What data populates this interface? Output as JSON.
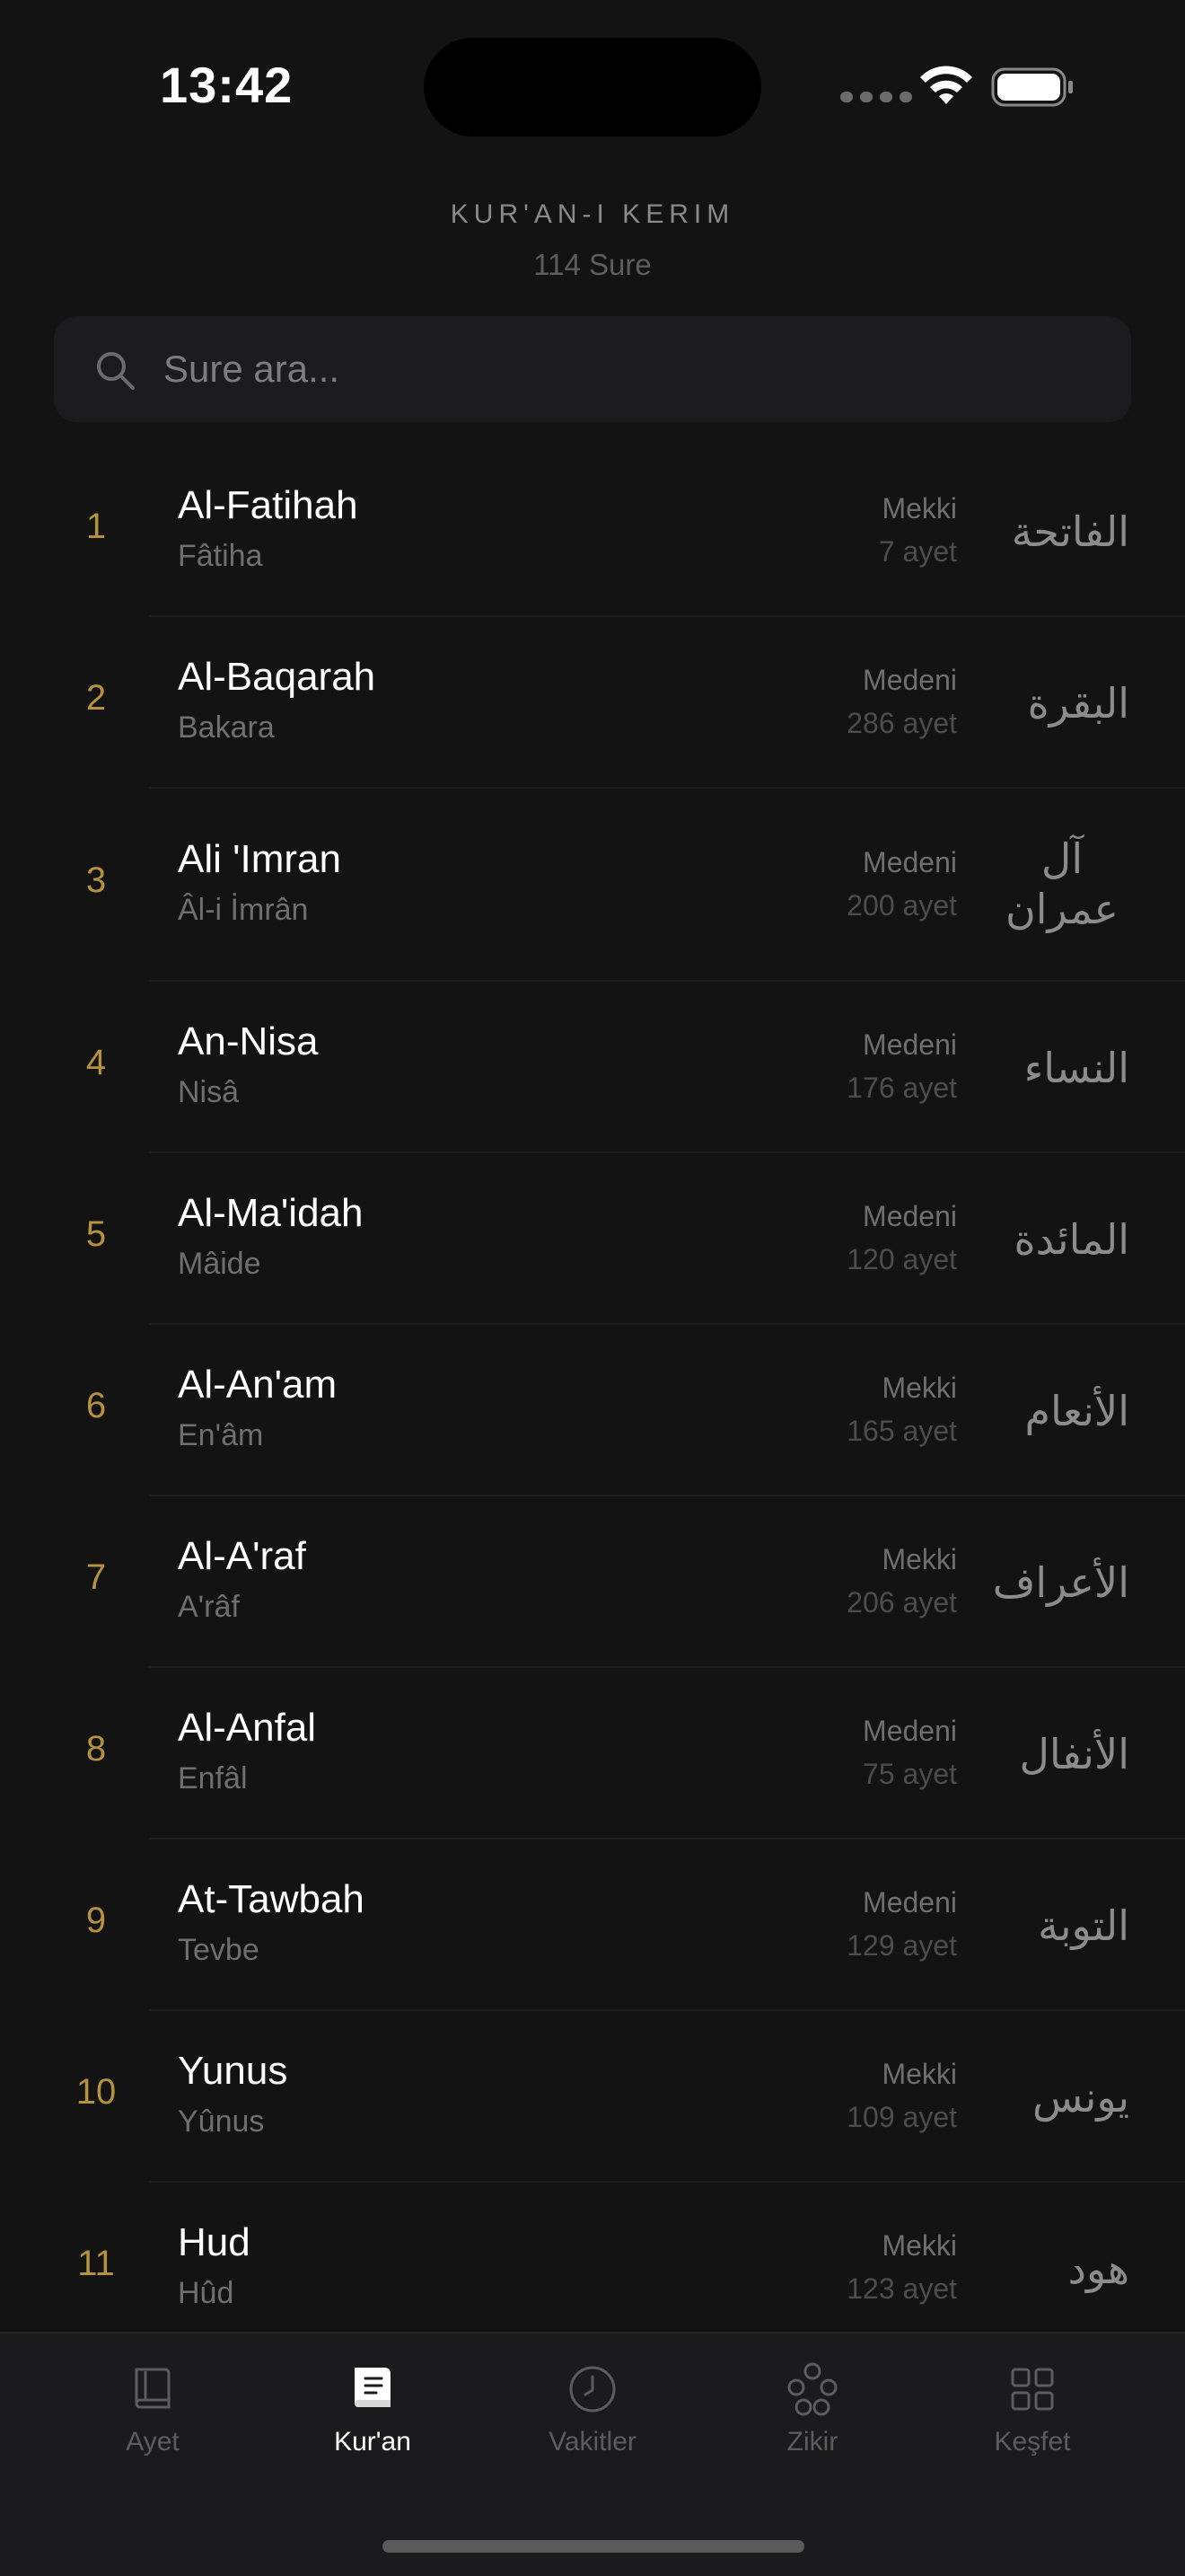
{
  "status_bar": {
    "time": "13:42"
  },
  "header": {
    "title": "KUR'AN-I KERIM",
    "subtitle": "114 Sure"
  },
  "search": {
    "placeholder": "Sure ara..."
  },
  "surahs": [
    {
      "number": "1",
      "name": "Al-Fatihah",
      "turkish": "Fâtiha",
      "type": "Mekki",
      "verses": "7 ayet",
      "arabic": "الفاتحة"
    },
    {
      "number": "2",
      "name": "Al-Baqarah",
      "turkish": "Bakara",
      "type": "Medeni",
      "verses": "286 ayet",
      "arabic": "البقرة"
    },
    {
      "number": "3",
      "name": "Ali 'Imran",
      "turkish": "Âl-i İmrân",
      "type": "Medeni",
      "verses": "200 ayet",
      "arabic": "آل عمران"
    },
    {
      "number": "4",
      "name": "An-Nisa",
      "turkish": "Nisâ",
      "type": "Medeni",
      "verses": "176 ayet",
      "arabic": "النساء"
    },
    {
      "number": "5",
      "name": "Al-Ma'idah",
      "turkish": "Mâide",
      "type": "Medeni",
      "verses": "120 ayet",
      "arabic": "المائدة"
    },
    {
      "number": "6",
      "name": "Al-An'am",
      "turkish": "En'âm",
      "type": "Mekki",
      "verses": "165 ayet",
      "arabic": "الأنعام"
    },
    {
      "number": "7",
      "name": "Al-A'raf",
      "turkish": "A'râf",
      "type": "Mekki",
      "verses": "206 ayet",
      "arabic": "الأعراف"
    },
    {
      "number": "8",
      "name": "Al-Anfal",
      "turkish": "Enfâl",
      "type": "Medeni",
      "verses": "75 ayet",
      "arabic": "الأنفال"
    },
    {
      "number": "9",
      "name": "At-Tawbah",
      "turkish": "Tevbe",
      "type": "Medeni",
      "verses": "129 ayet",
      "arabic": "التوبة"
    },
    {
      "number": "10",
      "name": "Yunus",
      "turkish": "Yûnus",
      "type": "Mekki",
      "verses": "109 ayet",
      "arabic": "يونس"
    },
    {
      "number": "11",
      "name": "Hud",
      "turkish": "Hûd",
      "type": "Mekki",
      "verses": "123 ayet",
      "arabic": "هود"
    }
  ],
  "tabs": [
    {
      "label": "Ayet",
      "icon": "book-icon",
      "active": false
    },
    {
      "label": "Kur'an",
      "icon": "quran-icon",
      "active": true
    },
    {
      "label": "Vakitler",
      "icon": "clock-icon",
      "active": false
    },
    {
      "label": "Zikir",
      "icon": "beads-icon",
      "active": false
    },
    {
      "label": "Keşfet",
      "icon": "grid-icon",
      "active": false
    }
  ],
  "colors": {
    "background": "#131313",
    "accent": "#b4923f",
    "tabbar": "#1b1b1d"
  }
}
